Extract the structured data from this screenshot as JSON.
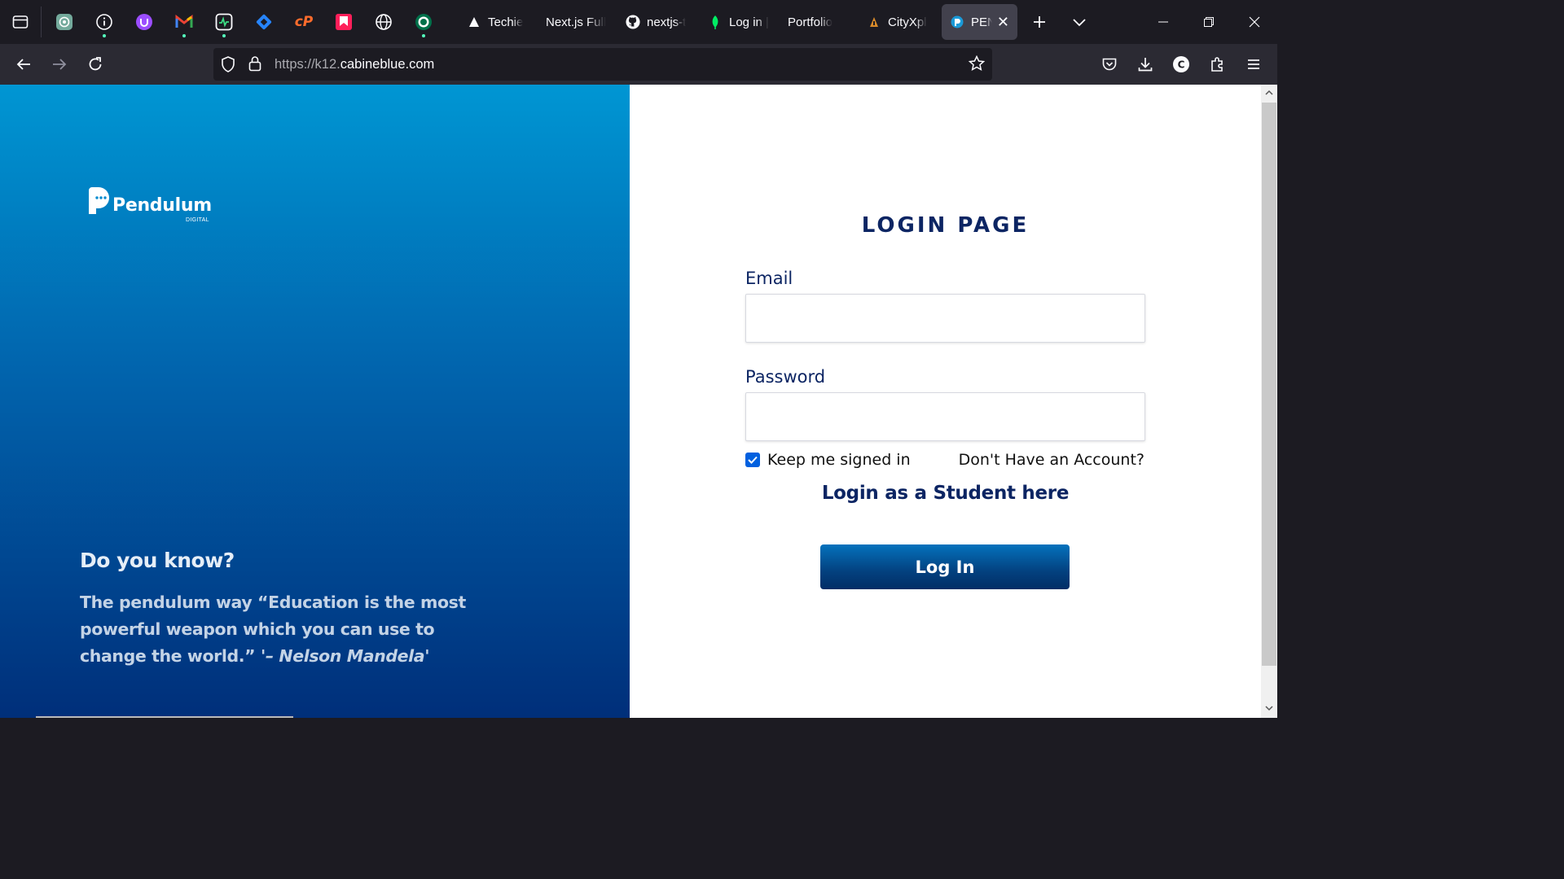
{
  "browser": {
    "pinned_tabs": [
      {
        "name": "chatgpt",
        "icon": "chatgpt-icon"
      },
      {
        "name": "info",
        "icon": "info-icon"
      },
      {
        "name": "upwork",
        "icon": "upwork-icon"
      },
      {
        "name": "gmail",
        "icon": "gmail-icon"
      },
      {
        "name": "activity",
        "icon": "pulse-icon"
      },
      {
        "name": "jira",
        "icon": "jira-icon"
      },
      {
        "name": "cpanel",
        "icon": "cpanel-icon"
      },
      {
        "name": "bookmark",
        "icon": "bookmark-app-icon"
      },
      {
        "name": "globe",
        "icon": "globe-icon"
      },
      {
        "name": "starbucks",
        "icon": "starbucks-icon"
      }
    ],
    "tabs": [
      {
        "label": "Techie",
        "icon": "triangle-icon"
      },
      {
        "label": "Next.js Full",
        "icon": ""
      },
      {
        "label": "nextjs-t",
        "icon": "github-icon"
      },
      {
        "label": "Log in |",
        "icon": "leaf-icon"
      },
      {
        "label": "Portfolio",
        "icon": ""
      },
      {
        "label": "CityXpl",
        "icon": "cityxplor-icon"
      },
      {
        "label": "PEN",
        "icon": "pendulum-icon",
        "active": true
      }
    ],
    "url": {
      "prefix": "https://k12.",
      "domain": "cabineblue.com"
    }
  },
  "hero": {
    "logo_text": "Pendulum",
    "logo_sub": "DIGITAL",
    "know_title": "Do you know?",
    "quote_text": "The pendulum way “Education is the most powerful weapon which you can use to change the world.”",
    "quote_author": "'– Nelson Mandela'"
  },
  "form": {
    "title": "LOGIN PAGE",
    "email_label": "Email",
    "email_value": "",
    "password_label": "Password",
    "password_value": "",
    "remember_label": "Keep me signed in",
    "remember_checked": true,
    "no_account_text": "Don't Have an Account?",
    "student_link": "Login as a Student here",
    "login_button": "Log In"
  },
  "colors": {
    "brand_navy": "#0c2563",
    "hero_top": "#0096d3",
    "hero_bottom": "#002f7a",
    "checkbox": "#0060df"
  }
}
